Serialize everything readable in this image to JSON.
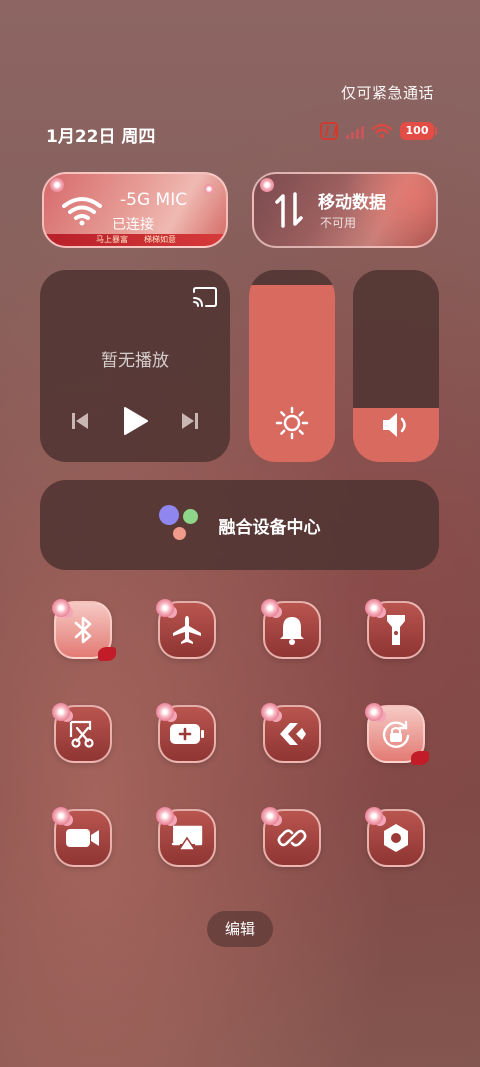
{
  "status": {
    "emergency_text": "仅可紧急通话",
    "date_text": "1月22日 周四",
    "battery_level": "100",
    "icons": [
      "nfc-icon",
      "signal-icon",
      "wifi-icon",
      "battery-icon"
    ]
  },
  "tiles": {
    "wifi": {
      "ssid": "-5G MIC",
      "status": "已连接",
      "decor_text_left": "马上暴富",
      "decor_text_right": "梯梯如意"
    },
    "mobile_data": {
      "title": "移动数据",
      "status": "不可用"
    }
  },
  "media": {
    "empty_text": "暂无播放"
  },
  "sliders": {
    "brightness_level": 0.92,
    "volume_level": 0.28
  },
  "device_center": {
    "label": "融合设备中心"
  },
  "toggles": [
    {
      "name": "bluetooth",
      "icon": "bluetooth-icon",
      "active": true
    },
    {
      "name": "airplane-mode",
      "icon": "airplane-icon",
      "active": false
    },
    {
      "name": "ring-mode",
      "icon": "bell-icon",
      "active": false
    },
    {
      "name": "flashlight",
      "icon": "flashlight-icon",
      "active": false
    },
    {
      "name": "screenshot",
      "icon": "scissors-icon",
      "active": false
    },
    {
      "name": "battery-saver",
      "icon": "battery-plus-icon",
      "active": false
    },
    {
      "name": "share",
      "icon": "share-icon",
      "active": false
    },
    {
      "name": "rotation-lock",
      "icon": "rotation-lock-icon",
      "active": true
    },
    {
      "name": "screen-record",
      "icon": "video-icon",
      "active": false
    },
    {
      "name": "screen-cast",
      "icon": "cast-screen-icon",
      "active": false
    },
    {
      "name": "multi-link",
      "icon": "link-icon",
      "active": false
    },
    {
      "name": "settings",
      "icon": "nut-icon",
      "active": false
    }
  ],
  "edit": {
    "label": "编辑"
  },
  "colors": {
    "accent": "#d86a5f",
    "panel": "#503432",
    "dot_purple": "#8f86f0",
    "dot_green": "#8ed68a",
    "dot_pink": "#f09a8c"
  }
}
